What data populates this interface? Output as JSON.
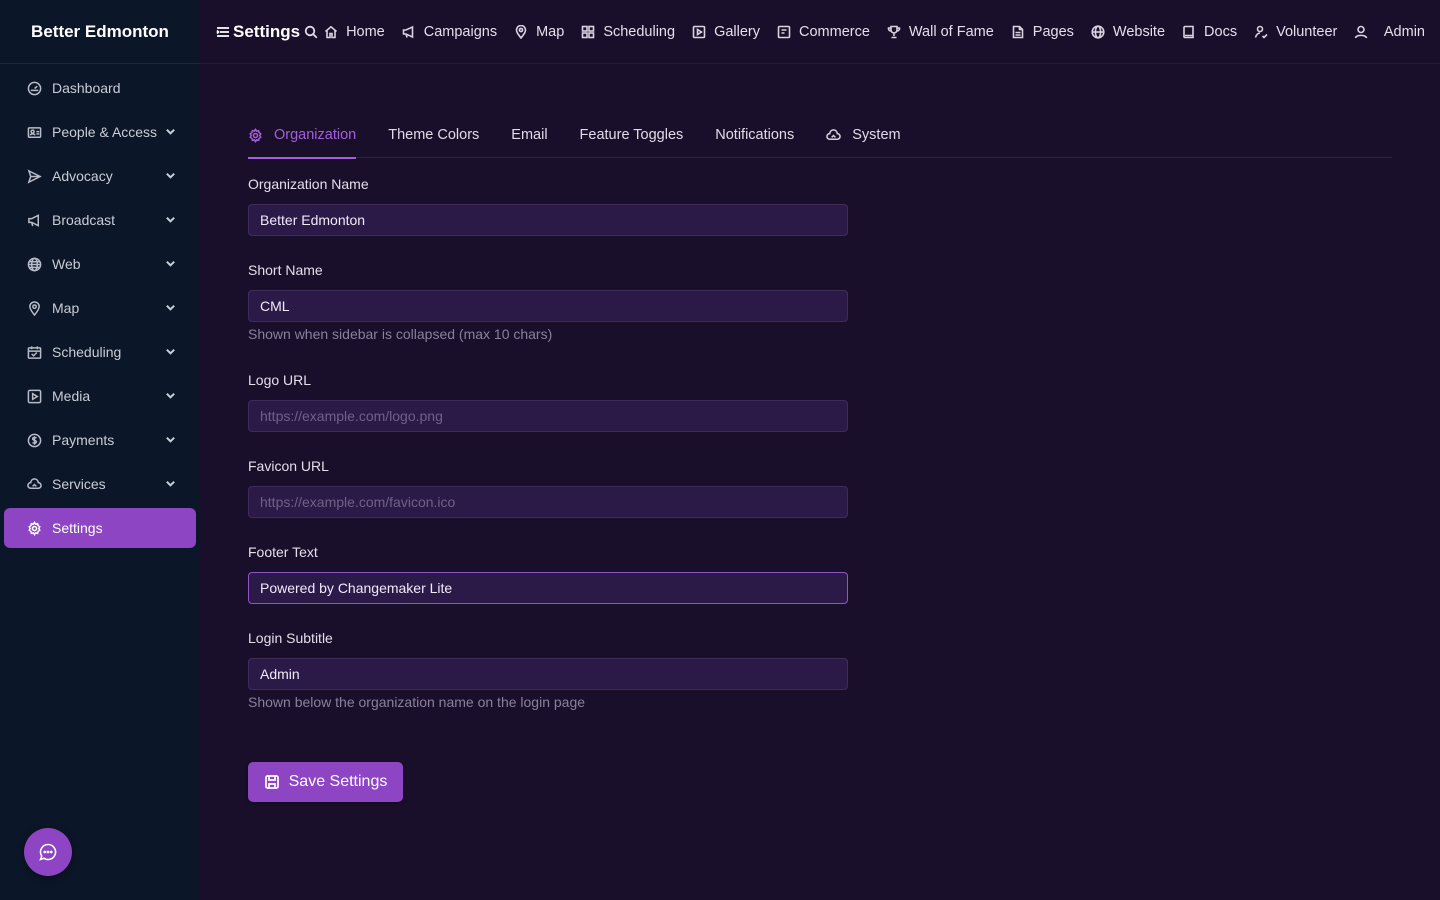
{
  "brand": "Better Edmonton",
  "sidebar": {
    "items": [
      {
        "label": "Dashboard",
        "icon": "dashboard-icon"
      },
      {
        "label": "People & Access",
        "icon": "people-icon"
      },
      {
        "label": "Advocacy",
        "icon": "send-icon"
      },
      {
        "label": "Broadcast",
        "icon": "megaphone-icon"
      },
      {
        "label": "Web",
        "icon": "globe-icon"
      },
      {
        "label": "Map",
        "icon": "map-pin-icon"
      },
      {
        "label": "Scheduling",
        "icon": "calendar-icon"
      },
      {
        "label": "Media",
        "icon": "media-icon"
      },
      {
        "label": "Payments",
        "icon": "dollar-icon"
      },
      {
        "label": "Services",
        "icon": "cloud-icon"
      },
      {
        "label": "Settings",
        "icon": "gear-icon",
        "active": true
      }
    ]
  },
  "topbar": {
    "title": "Settings",
    "links": [
      {
        "label": "Home",
        "icon": "home-icon"
      },
      {
        "label": "Campaigns",
        "icon": "megaphone-icon"
      },
      {
        "label": "Map",
        "icon": "map-pin-icon"
      },
      {
        "label": "Scheduling",
        "icon": "grid-icon"
      },
      {
        "label": "Gallery",
        "icon": "play-icon"
      },
      {
        "label": "Commerce",
        "icon": "receipt-icon"
      },
      {
        "label": "Wall of Fame",
        "icon": "trophy-icon"
      },
      {
        "label": "Pages",
        "icon": "file-icon"
      },
      {
        "label": "Website",
        "icon": "globe-icon"
      },
      {
        "label": "Docs",
        "icon": "book-icon"
      },
      {
        "label": "Volunteer",
        "icon": "volunteer-icon"
      }
    ],
    "admin": "Admin"
  },
  "tabs": [
    {
      "label": "Organization",
      "active": true,
      "icon": "gear-icon"
    },
    {
      "label": "Theme Colors"
    },
    {
      "label": "Email"
    },
    {
      "label": "Feature Toggles"
    },
    {
      "label": "Notifications"
    },
    {
      "label": "System",
      "icon": "cloud-icon"
    }
  ],
  "form": {
    "org_name": {
      "label": "Organization Name",
      "value": "Better Edmonton"
    },
    "short_name": {
      "label": "Short Name",
      "value": "CML",
      "help": "Shown when sidebar is collapsed (max 10 chars)"
    },
    "logo_url": {
      "label": "Logo URL",
      "value": "",
      "placeholder": "https://example.com/logo.png"
    },
    "favicon_url": {
      "label": "Favicon URL",
      "value": "",
      "placeholder": "https://example.com/favicon.ico"
    },
    "footer_text": {
      "label": "Footer Text",
      "value": "Powered by Changemaker Lite"
    },
    "login_subtitle": {
      "label": "Login Subtitle",
      "value": "Admin",
      "help": "Shown below the organization name on the login page"
    }
  },
  "save_label": "Save Settings",
  "colors": {
    "accent": "#8d45c4",
    "sidebar_bg": "#0b1628",
    "main_bg": "#1a0f2a",
    "input_bg": "#2b1a48"
  }
}
